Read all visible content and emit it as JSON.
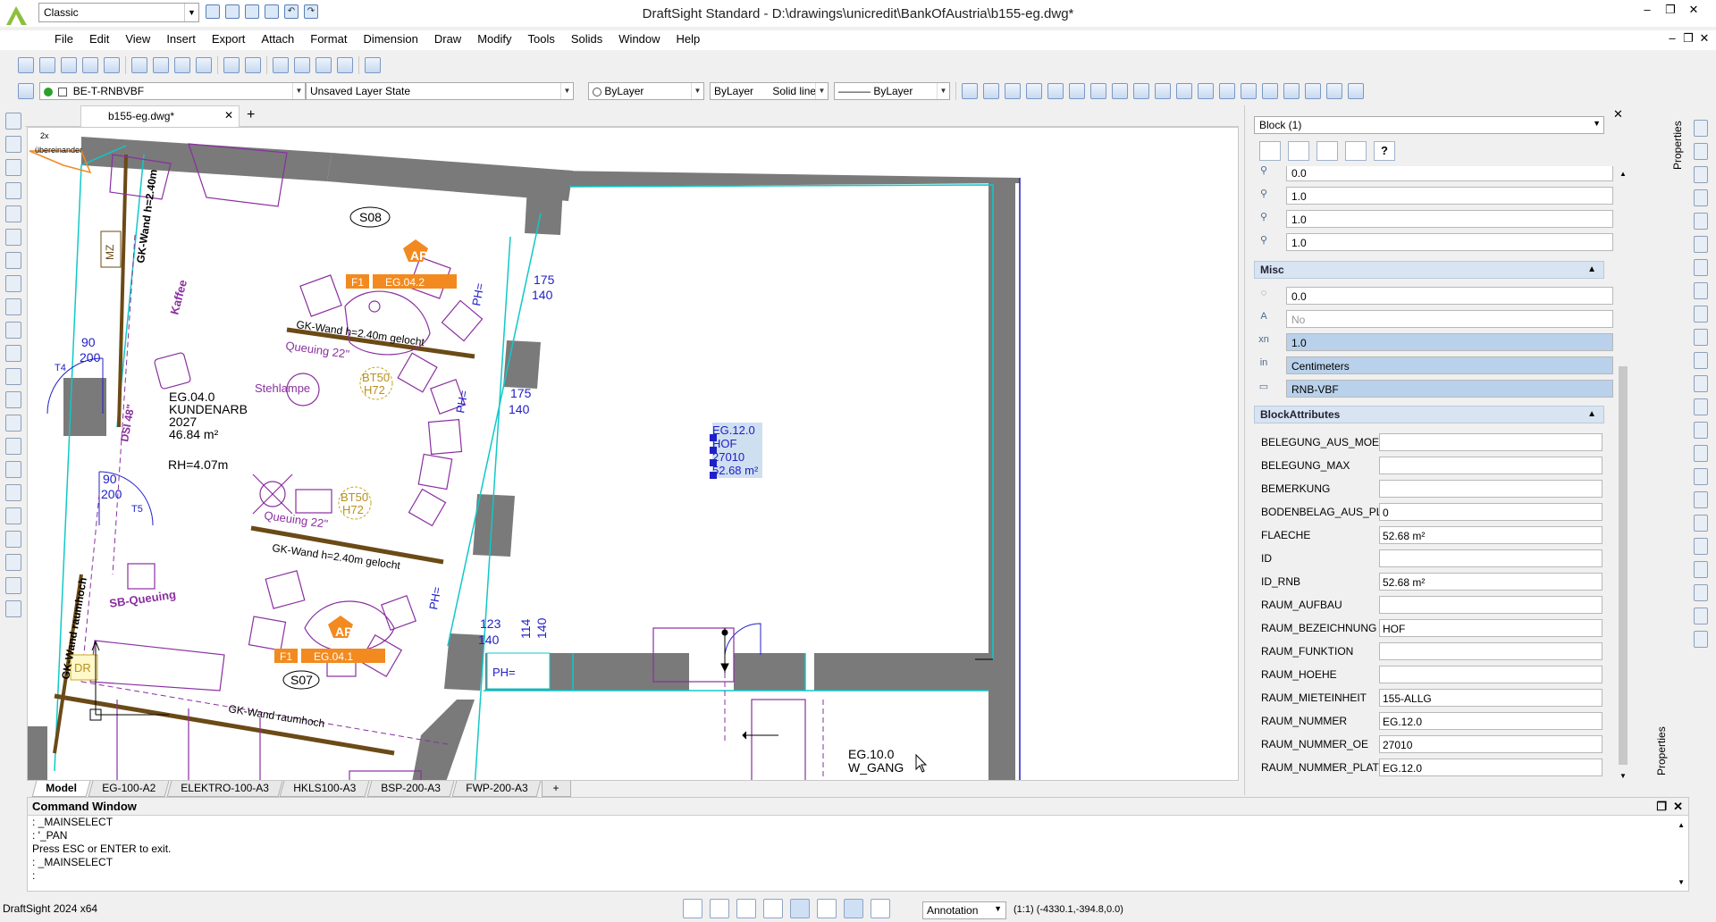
{
  "titlebar": {
    "workspace": "Classic",
    "title": "DraftSight Standard - D:\\drawings\\unicredit\\BankOfAustria\\b155-eg.dwg*"
  },
  "menu": [
    "File",
    "Edit",
    "View",
    "Insert",
    "Export",
    "Attach",
    "Format",
    "Dimension",
    "Draw",
    "Modify",
    "Tools",
    "Solids",
    "Window",
    "Help"
  ],
  "layer_toolbar": {
    "layer": "BE-T-RNBVBF",
    "layer_state": "Unsaved Layer State",
    "color": "ByLayer",
    "linestyle_label": "ByLayer",
    "linestyle_name": "Solid line",
    "lineweight": "——— ByLayer"
  },
  "document_tab": "b155-eg.dwg*",
  "layout_tabs": [
    "Model",
    "EG-100-A2",
    "ELEKTRO-100-A3",
    "HKLS100-A3",
    "BSP-200-A3",
    "FWP-200-A3"
  ],
  "drawing": {
    "labels": {
      "room1": [
        "EG.04.0",
        "KUNDENARB",
        "2027",
        "46.84 m²"
      ],
      "rh": "RH=4.07m",
      "room_sel": [
        "EG.12.0",
        "HOF",
        "27010",
        "52.68 m²"
      ],
      "room_gang": [
        "EG.10.0",
        "W_GANG"
      ],
      "s08": "S08",
      "s07": "S07",
      "ap": "AP",
      "f1": "F1",
      "eg042": "EG.04.2",
      "eg041": "EG.04.1",
      "gk1": "GK-Wand h=2.40m gelocht",
      "gk2": "GK-Wand h=2.40m gelocht",
      "gk3": "GK-Wand raumhoch",
      "gk4": "GK-Wand raumhoch",
      "gk5": "GK-Wand h=2.40m",
      "queuing1": "Queuing 22\"",
      "queuing2": "Queuing 22\"",
      "stehlampe": "Stehlampe",
      "kaffee": "Kaffee",
      "sbqueuing": "SB-Queuing",
      "bt50": "BT50",
      "h72": "H72",
      "dsi": "DSI 48\"",
      "ph": "PH=",
      "d175": "175",
      "d140": "140",
      "d123": "123",
      "d114": "114",
      "d90": "90",
      "d200": "200",
      "t4": "T4",
      "t5": "T5",
      "mz": "MZ",
      "dr": "DR",
      "corner_2x": "2x",
      "corner_ueber": "übereinander"
    }
  },
  "properties": {
    "selector": "Block (1)",
    "geom_rows": [
      "0.0",
      "1.0",
      "1.0",
      "1.0"
    ],
    "misc_title": "Misc",
    "misc_rows": [
      {
        "icon": "rotation-icon",
        "value": "0.0",
        "state": ""
      },
      {
        "icon": "annotative-icon",
        "value": "No",
        "state": "dis"
      },
      {
        "icon": "unit-factor-icon",
        "value": "1.0",
        "state": "sel"
      },
      {
        "icon": "units-icon",
        "value": "Centimeters",
        "state": "sel"
      },
      {
        "icon": "block-name-icon",
        "value": "RNB-VBF",
        "state": "sel"
      }
    ],
    "attr_title": "BlockAttributes",
    "attributes": [
      {
        "name": "BELEGUNG_AUS_MOEBLI...",
        "value": ""
      },
      {
        "name": "BELEGUNG_MAX",
        "value": ""
      },
      {
        "name": "BEMERKUNG",
        "value": ""
      },
      {
        "name": "BODENBELAG_AUS_PLAN",
        "value": "0"
      },
      {
        "name": "FLAECHE",
        "value": "52.68 m²"
      },
      {
        "name": "ID",
        "value": ""
      },
      {
        "name": "ID_RNB",
        "value": "52.68 m²"
      },
      {
        "name": "RAUM_AUFBAU",
        "value": ""
      },
      {
        "name": "RAUM_BEZEICHNUNG",
        "value": "HOF"
      },
      {
        "name": "RAUM_FUNKTION",
        "value": ""
      },
      {
        "name": "RAUM_HOEHE",
        "value": ""
      },
      {
        "name": "RAUM_MIETEINHEIT",
        "value": "155-ALLG"
      },
      {
        "name": "RAUM_NUMMER",
        "value": "EG.12.0"
      },
      {
        "name": "RAUM_NUMMER_OE",
        "value": "27010"
      },
      {
        "name": "RAUM_NUMMER_PLATZH...",
        "value": "EG.12.0"
      }
    ],
    "side_tab": "Properties",
    "side_tab_bottom": "Properties"
  },
  "command_window": {
    "title": "Command Window",
    "lines": [
      ": _MAINSELECT",
      ": '_PAN",
      "Press ESC or ENTER to exit.",
      ": _MAINSELECT",
      ":"
    ]
  },
  "status": {
    "app": "DraftSight 2024 x64",
    "annotation": "Annotation",
    "scale": "(1:1)",
    "coords": "(-4330.1,-394.8,0.0)"
  },
  "colors": {
    "accent": "#3a6fb0",
    "select": "#b9d1ea",
    "orange": "#f28a1f",
    "purple": "#8a2fa0",
    "wall": "#7a7a7a",
    "blue": "#2020c8"
  }
}
